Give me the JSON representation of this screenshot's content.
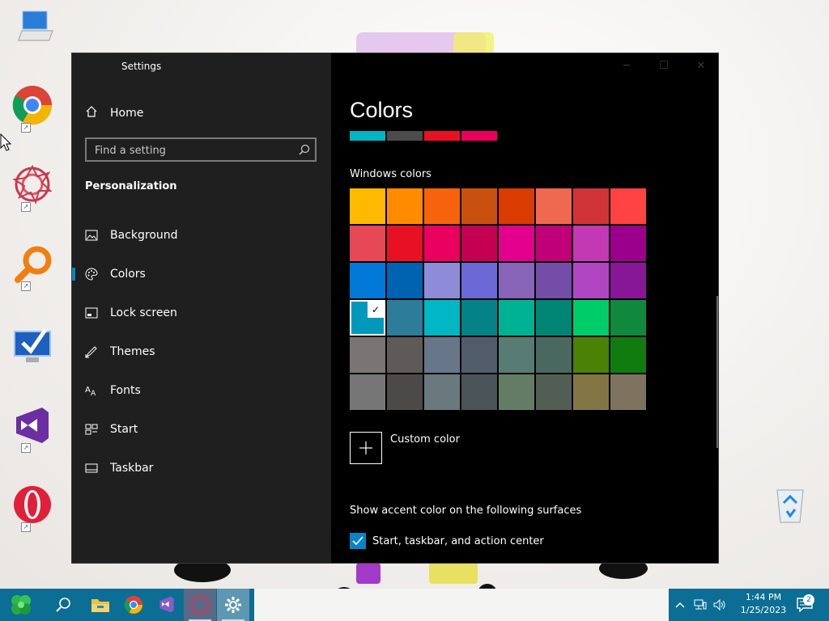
{
  "window": {
    "title": "Settings"
  },
  "sidebar": {
    "home_label": "Home",
    "search_placeholder": "Find a setting",
    "section_title": "Personalization",
    "items": [
      {
        "label": "Background",
        "icon": "background-icon",
        "selected": false
      },
      {
        "label": "Colors",
        "icon": "palette-icon",
        "selected": true
      },
      {
        "label": "Lock screen",
        "icon": "lock-screen-icon",
        "selected": false
      },
      {
        "label": "Themes",
        "icon": "themes-icon",
        "selected": false
      },
      {
        "label": "Fonts",
        "icon": "fonts-icon",
        "selected": false
      },
      {
        "label": "Start",
        "icon": "start-icon",
        "selected": false
      },
      {
        "label": "Taskbar",
        "icon": "taskbar-icon",
        "selected": false
      }
    ]
  },
  "content": {
    "page_title": "Colors",
    "preview_colors": [
      "#00b4c4",
      "#4c4c4c",
      "#e81123",
      "#ea005e"
    ],
    "windows_colors_heading": "Windows colors",
    "swatches": [
      [
        "#FFB900",
        "#FF8C00",
        "#F7630C",
        "#CA5010",
        "#DA3B01",
        "#EF6950",
        "#D13438",
        "#FF4343"
      ],
      [
        "#E74856",
        "#E81123",
        "#EA005E",
        "#C30052",
        "#E3008C",
        "#BF0077",
        "#C239B3",
        "#9A0089"
      ],
      [
        "#0078D7",
        "#0063B1",
        "#8E8CD8",
        "#6B69D6",
        "#8764B8",
        "#744DA9",
        "#B146C2",
        "#881798"
      ],
      [
        "#0099BC",
        "#2D7D9A",
        "#00B7C3",
        "#038387",
        "#00B294",
        "#018574",
        "#00CC6A",
        "#10893E"
      ],
      [
        "#7A7574",
        "#5D5A58",
        "#68768A",
        "#515C6B",
        "#567C73",
        "#486860",
        "#498205",
        "#107C10"
      ],
      [
        "#767676",
        "#4C4A48",
        "#69797E",
        "#4A5459",
        "#647C64",
        "#525E54",
        "#847545",
        "#7E735F"
      ]
    ],
    "selected_swatch": {
      "row": 3,
      "col": 0
    },
    "custom_color_label": "Custom color",
    "accent_heading": "Show accent color on the following surfaces",
    "accent_checkbox_label": "Start, taskbar, and action center",
    "accent_checkbox_checked": true
  },
  "taskbar": {
    "apps": [
      "start-button",
      "search-icon",
      "file-explorer-icon",
      "chrome-icon",
      "visual-studio-icon",
      "opera-icon",
      "settings-icon"
    ],
    "active_app": "settings-icon",
    "clock_time": "1:44 PM",
    "clock_date": "1/25/2023",
    "notification_count": "2"
  },
  "desktop": {
    "icons": [
      "this-pc-icon",
      "chrome-icon",
      "app-mandala-icon",
      "search-magnifier-icon",
      "monitor-check-icon",
      "visual-studio-icon",
      "opera-icon",
      "recycle-bin-icon"
    ]
  },
  "colors": {
    "accent": "#0a84c6",
    "taskbar": "#0c6e94",
    "sidebar": "#1f1f1f"
  }
}
